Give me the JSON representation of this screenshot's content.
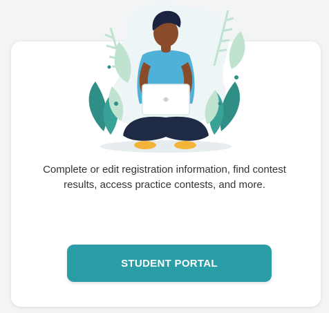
{
  "portal_card": {
    "description": "Complete or edit registration information, find contest results, access practice contests, and more.",
    "button_label": "STUDENT PORTAL",
    "illustration": "student-with-laptop-icon",
    "colors": {
      "accent": "#2a9da7",
      "leaf_dark": "#2f8e85",
      "leaf_light": "#bfe3cf",
      "shirt": "#4fb0d8",
      "pants": "#1f2a44",
      "shoes": "#f4b43a",
      "skin": "#8a4b2a",
      "hair": "#1b2340"
    }
  }
}
